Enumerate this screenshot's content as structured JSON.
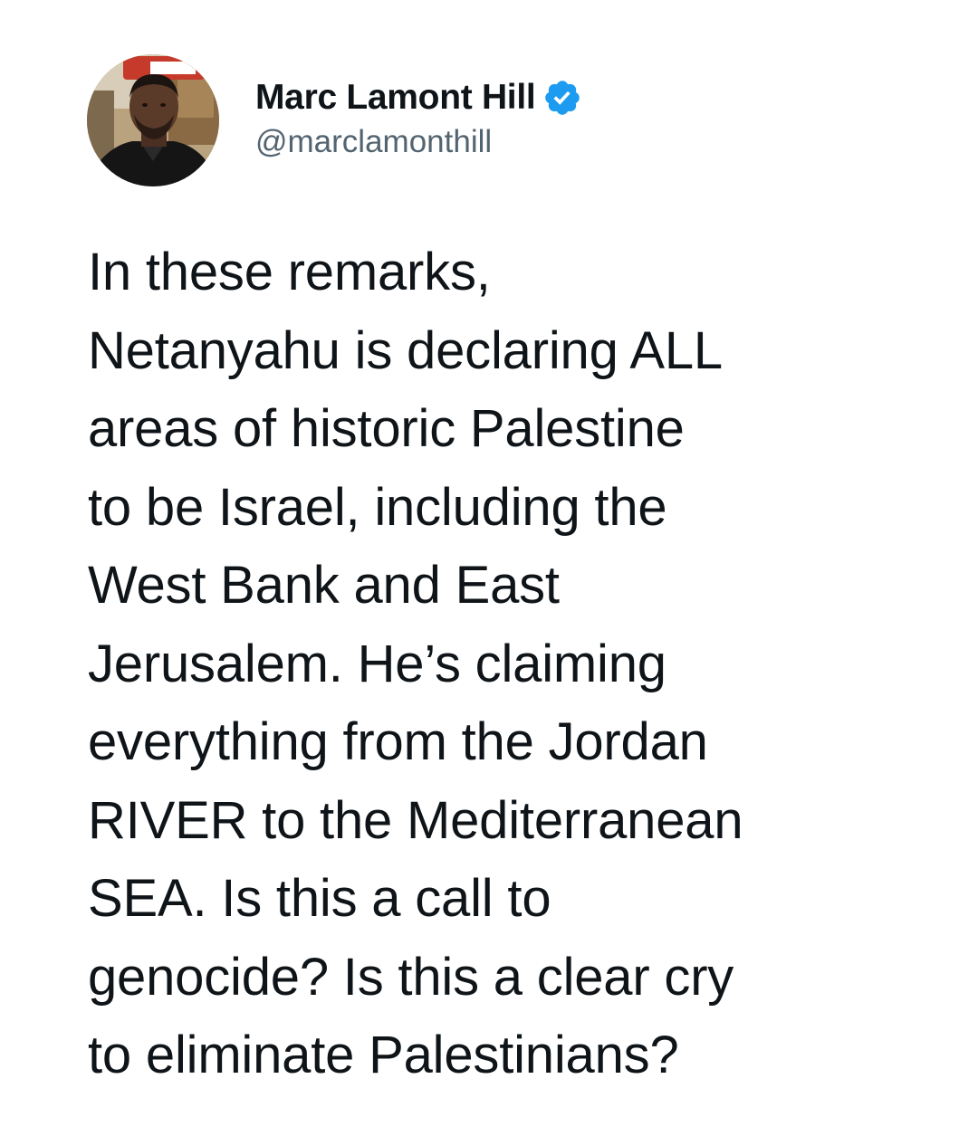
{
  "author": {
    "display_name": "Marc Lamont Hill",
    "handle": "@marclamonthill",
    "verified": true,
    "verified_color": "#1d9bf0",
    "avatar_icon": "profile-photo"
  },
  "tweet": {
    "lines": [
      "In these remarks,",
      "Netanyahu is declaring ALL",
      "areas of historic Palestine",
      "to be Israel, including the",
      "West Bank and East",
      "Jerusalem. He’s claiming",
      "everything from the Jordan",
      "RIVER to the Mediterranean",
      "SEA. Is this a call to",
      "genocide? Is this a clear cry",
      "to eliminate Palestinians?"
    ]
  },
  "colors": {
    "text_primary": "#0f1419",
    "text_secondary": "#536471",
    "background": "#ffffff"
  }
}
